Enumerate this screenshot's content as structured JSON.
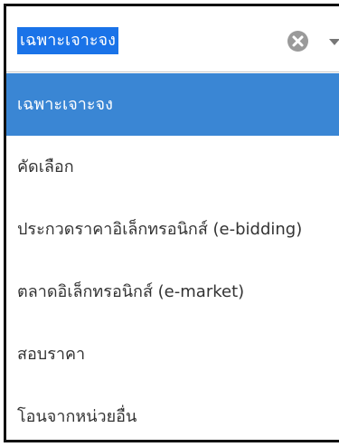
{
  "select": {
    "selected_value": "เฉพาะเจาะจง",
    "clear_icon": "clear-x-icon",
    "caret_icon": "caret-down-icon"
  },
  "options": [
    {
      "label": "เฉพาะเจาะจง",
      "active": true
    },
    {
      "label": "คัดเลือก",
      "active": false
    },
    {
      "label": "ประกวดราคาอิเล็กทรอนิกส์ (e-bidding)",
      "active": false
    },
    {
      "label": "ตลาดอิเล็กทรอนิกส์ (e-market)",
      "active": false
    },
    {
      "label": "สอบราคา",
      "active": false
    },
    {
      "label": "โอนจากหน่วยอื่น",
      "active": false
    }
  ],
  "colors": {
    "highlight": "#3a86d4",
    "selection": "#1a73e8",
    "text": "#333333"
  }
}
